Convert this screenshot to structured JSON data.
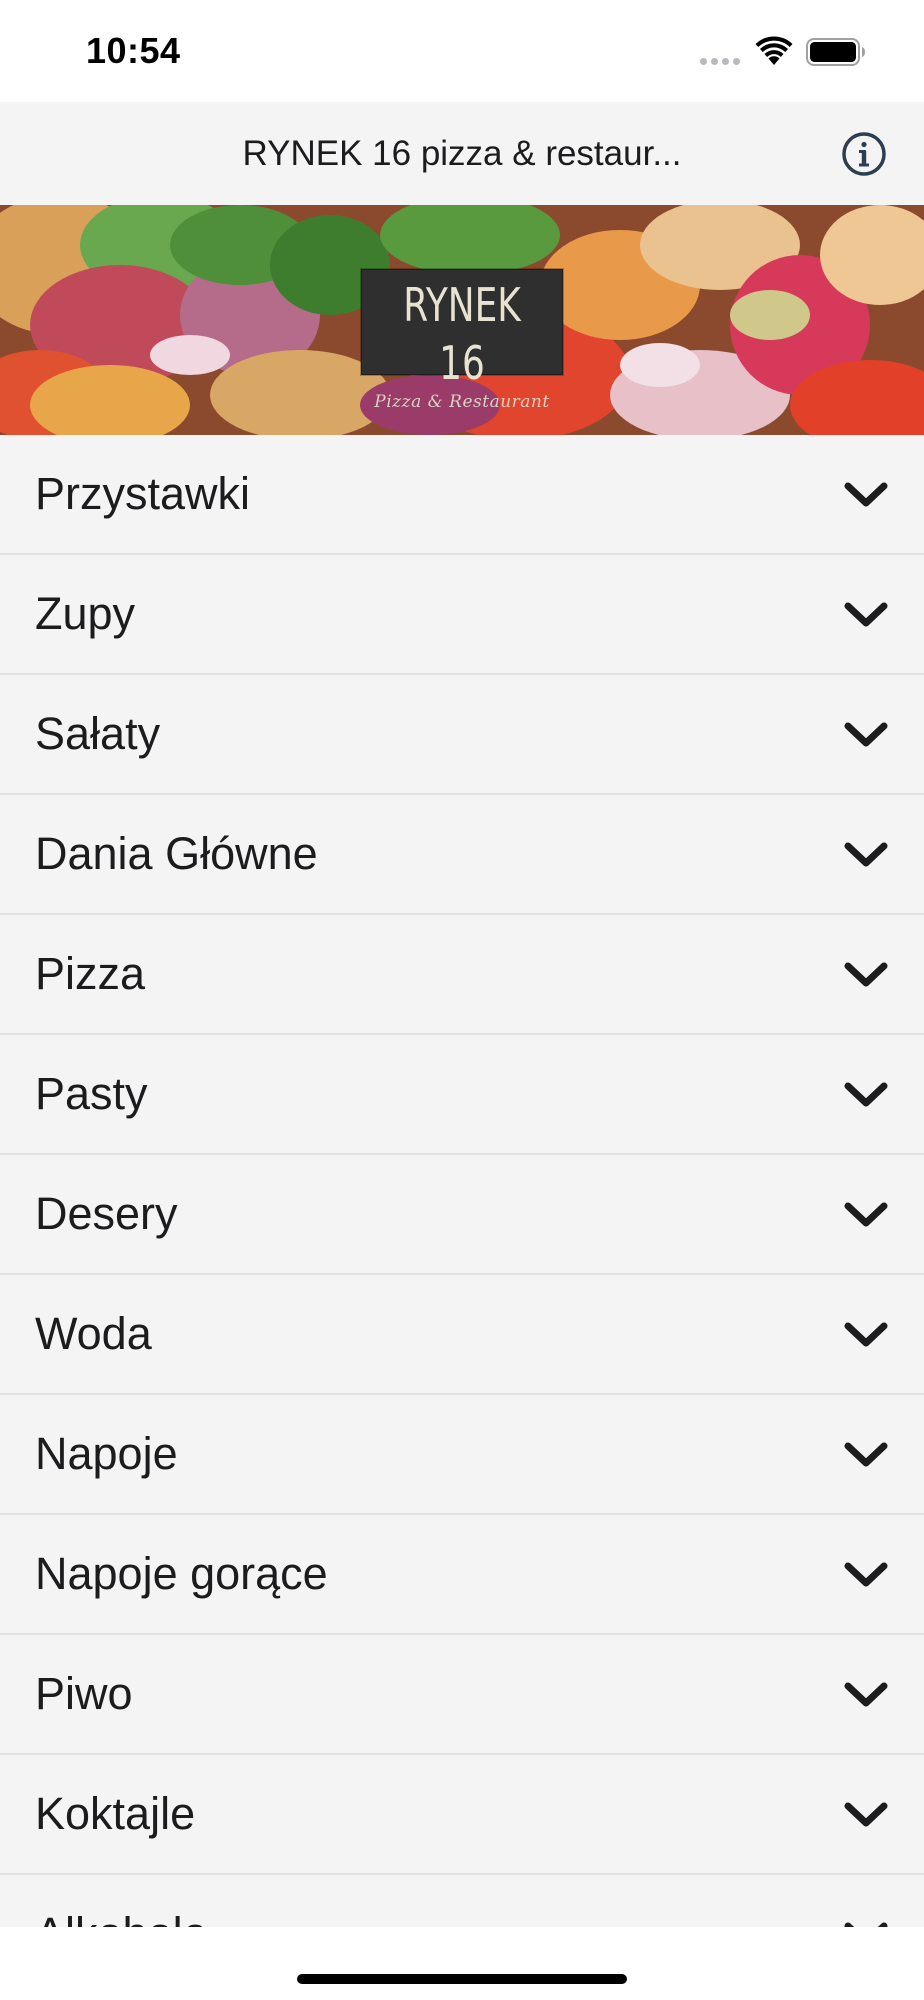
{
  "status_bar": {
    "time": "10:54",
    "icons": [
      "cellular-signal-icon",
      "wifi-icon",
      "battery-icon"
    ]
  },
  "nav": {
    "title": "RYNEK 16 pizza & restaur...",
    "info_icon": "info-circle-icon"
  },
  "banner": {
    "logo_title": "RYNEK 16",
    "logo_subtitle": "Pizza & Restaurant"
  },
  "categories": [
    {
      "label": "Przystawki"
    },
    {
      "label": "Zupy"
    },
    {
      "label": "Sałaty"
    },
    {
      "label": "Dania Główne"
    },
    {
      "label": "Pizza"
    },
    {
      "label": "Pasty"
    },
    {
      "label": "Desery"
    },
    {
      "label": "Woda"
    },
    {
      "label": "Napoje"
    },
    {
      "label": "Napoje gorące"
    },
    {
      "label": "Piwo"
    },
    {
      "label": "Koktajle"
    },
    {
      "label": "Alkohole"
    }
  ],
  "category_icon": "chevron-down-icon",
  "colors": {
    "list_background": "#f4f4f4",
    "nav_background": "#f4f4f5",
    "divider": "#e2e2e4",
    "text": "#1c1c1e",
    "info_icon": "#2c3e50"
  }
}
